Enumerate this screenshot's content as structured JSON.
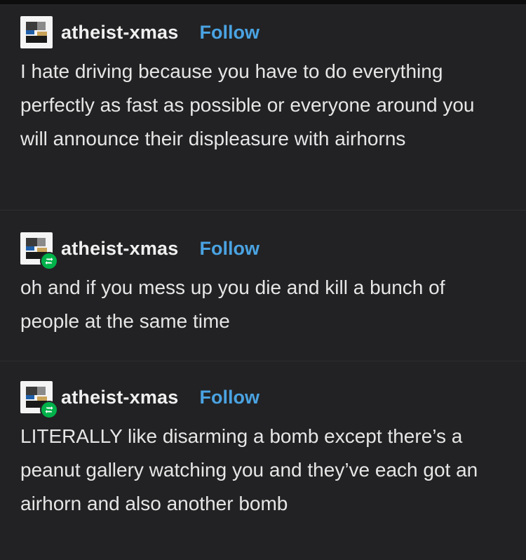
{
  "posts": [
    {
      "username": "atheist-xmas",
      "follow_label": "Follow",
      "reblog": false,
      "text": "I hate driving because you have to do everything perfectly as fast as possible or everyone around you will announce their displeasure with airhorns"
    },
    {
      "username": "atheist-xmas",
      "follow_label": "Follow",
      "reblog": true,
      "text": "oh and if you mess up you die and kill a bunch of people at the same time"
    },
    {
      "username": "atheist-xmas",
      "follow_label": "Follow",
      "reblog": true,
      "text": "LITERALLY like disarming a bomb except there’s a peanut gallery watching you and they’ve each got an airhorn and also another bomb"
    }
  ],
  "colors": {
    "background": "#222224",
    "follow": "#4aa3e2",
    "reblog_badge": "#00b24a"
  },
  "icons": {
    "avatar": "blog-avatar-icon",
    "reblog": "reblog-icon"
  }
}
